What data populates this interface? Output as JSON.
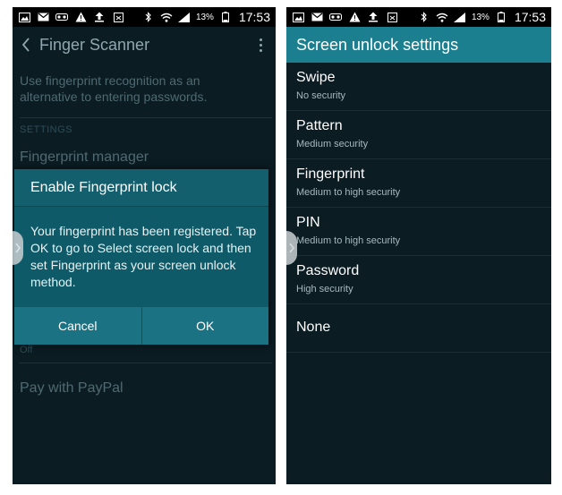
{
  "status_bar": {
    "battery_percent": "13%",
    "time": "17:53",
    "left_icons": [
      "picture-icon",
      "email-icon",
      "voicemail-icon",
      "warning-icon",
      "upload-icon",
      "clipboard-icon"
    ],
    "right_icons": [
      "bluetooth-icon",
      "wifi-icon",
      "signal-icon",
      "battery-icon"
    ]
  },
  "left_screen": {
    "header_title": "Finger Scanner",
    "description": "Use fingerprint recognition as an alternative to entering passwords.",
    "section_label": "SETTINGS",
    "items": [
      {
        "label": "Fingerprint manager"
      },
      {
        "label": "Off"
      },
      {
        "label": "Pay with PayPal"
      }
    ],
    "dialog": {
      "title": "Enable Fingerprint lock",
      "body": "Your fingerprint has been registered. Tap OK to go to Select screen lock and then set Fingerprint as your screen unlock method.",
      "cancel_label": "Cancel",
      "ok_label": "OK"
    }
  },
  "right_screen": {
    "header_title": "Screen unlock settings",
    "items": [
      {
        "title": "Swipe",
        "subtitle": "No security"
      },
      {
        "title": "Pattern",
        "subtitle": "Medium security"
      },
      {
        "title": "Fingerprint",
        "subtitle": "Medium to high security"
      },
      {
        "title": "PIN",
        "subtitle": "Medium to high security"
      },
      {
        "title": "Password",
        "subtitle": "High security"
      },
      {
        "title": "None"
      }
    ]
  },
  "colors": {
    "background": "#0b1c23",
    "accent": "#1c7f8f",
    "dialog": "#0e5a68"
  }
}
